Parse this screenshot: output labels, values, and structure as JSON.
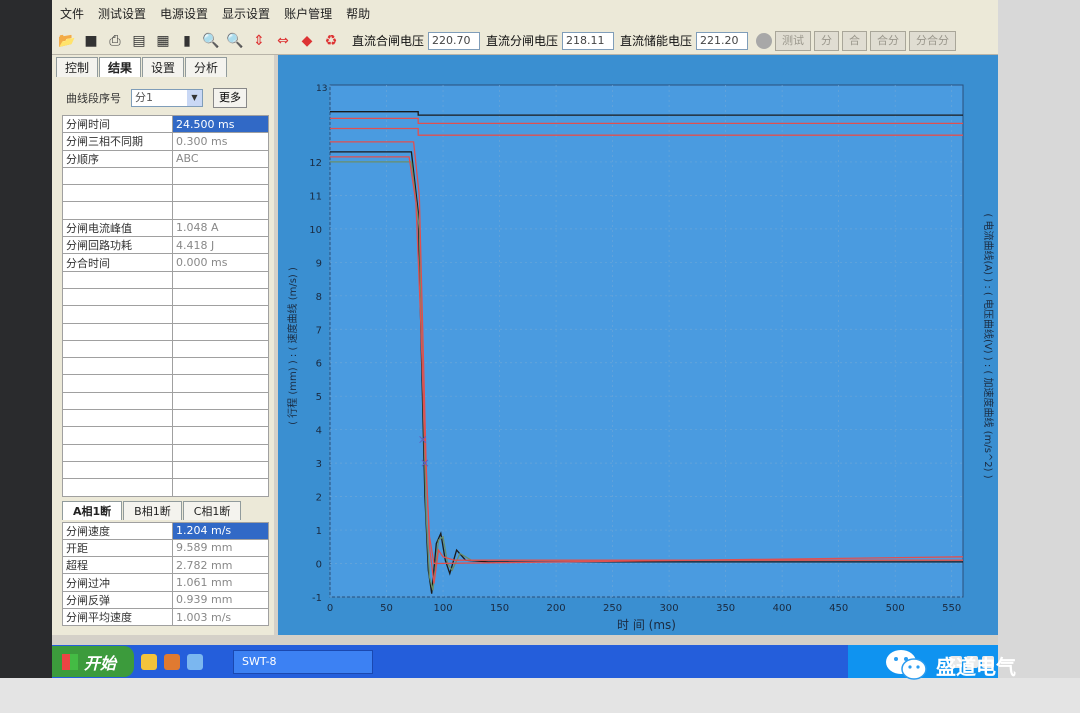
{
  "menu": [
    "文件",
    "测试设置",
    "电源设置",
    "显示设置",
    "账户管理",
    "帮助"
  ],
  "toolbar": {
    "icons": [
      "open-icon",
      "save-icon",
      "print-icon",
      "clipboard-icon",
      "export-icon",
      "book-icon",
      "zoom-out-icon",
      "zoom-in-icon",
      "vertical-scale-icon",
      "horizontal-scale-icon",
      "diamond-icon",
      "refresh-icon"
    ],
    "close_label": "直流合闸电压",
    "close_value": "220.70",
    "open_label": "直流分闸电压",
    "open_value": "218.11",
    "store_label": "直流储能电压",
    "store_value": "221.20",
    "btn_test": "测试",
    "btn_open": "分",
    "btn_close": "合",
    "btn_co": "合分",
    "btn_oc": "分合分"
  },
  "left": {
    "tabs": [
      "控制",
      "结果",
      "设置",
      "分析"
    ],
    "combo_label": "曲线段序号",
    "combo_value": "分1",
    "more_button": "更多",
    "rows": [
      {
        "label": "分闸时间",
        "value": "24.500  ms",
        "selected": true
      },
      {
        "label": "分闸三相不同期",
        "value": "0.300  ms"
      },
      {
        "label": "分顺序",
        "value": "ABC"
      },
      {
        "label": "",
        "value": ""
      },
      {
        "label": "",
        "value": ""
      },
      {
        "label": "",
        "value": ""
      },
      {
        "label": "分闸电流峰值",
        "value": "1.048  A"
      },
      {
        "label": "分闸回路功耗",
        "value": "4.418  J"
      },
      {
        "label": "分合时间",
        "value": "0.000  ms"
      },
      {
        "label": "",
        "value": ""
      },
      {
        "label": "",
        "value": ""
      },
      {
        "label": "",
        "value": ""
      },
      {
        "label": "",
        "value": ""
      },
      {
        "label": "",
        "value": ""
      },
      {
        "label": "",
        "value": ""
      },
      {
        "label": "",
        "value": ""
      },
      {
        "label": "",
        "value": ""
      },
      {
        "label": "",
        "value": ""
      },
      {
        "label": "",
        "value": ""
      },
      {
        "label": "",
        "value": ""
      },
      {
        "label": "",
        "value": ""
      },
      {
        "label": "",
        "value": ""
      }
    ],
    "phase_tabs": [
      "A相1断",
      "B相1断",
      "C相1断"
    ],
    "phase_rows": [
      {
        "label": "分闸速度",
        "value": "1.204  m/s",
        "selected": true
      },
      {
        "label": "开距",
        "value": "9.589  mm"
      },
      {
        "label": "超程",
        "value": "2.782  mm"
      },
      {
        "label": "分闸过冲",
        "value": "1.061  mm"
      },
      {
        "label": "分闸反弹",
        "value": "0.939  mm"
      },
      {
        "label": "分闸平均速度",
        "value": "1.003  m/s"
      }
    ]
  },
  "chart_data": {
    "type": "line",
    "xlabel": "时 间 (ms)",
    "ylabel_left": "( 行程 (mm) ) : ( 速度曲线 (m/s) )",
    "ylabel_right": "( 电流曲线(A) ) : ( 电压曲线(V) ) : ( 加速度曲线 (m/s^2) )",
    "xlim": [
      0,
      560
    ],
    "ylim": [
      -1,
      13
    ],
    "x_ticks": [
      0,
      50,
      100,
      150,
      200,
      250,
      300,
      350,
      400,
      450,
      500,
      550
    ],
    "y_ticks": [
      -1,
      0,
      1,
      2,
      3,
      4,
      5,
      6,
      7,
      8,
      9,
      10,
      11,
      12
    ],
    "top_tick_label": "13",
    "series": [
      {
        "color": "#1a1a1a",
        "points": [
          [
            0,
            12.3
          ],
          [
            72,
            12.3
          ],
          [
            78,
            10.5
          ],
          [
            81,
            6.0
          ],
          [
            84,
            2.0
          ],
          [
            87,
            -0.2
          ],
          [
            90,
            -0.9
          ],
          [
            94,
            0.6
          ],
          [
            98,
            0.9
          ],
          [
            102,
            0.1
          ],
          [
            106,
            -0.3
          ],
          [
            112,
            0.4
          ],
          [
            120,
            0.1
          ],
          [
            140,
            0.05
          ],
          [
            560,
            0.05
          ]
        ]
      },
      {
        "color": "#6a8f6a",
        "points": [
          [
            0,
            12.0
          ],
          [
            72,
            12.0
          ],
          [
            79,
            10.0
          ],
          [
            82,
            5.5
          ],
          [
            85,
            1.5
          ],
          [
            88,
            -0.4
          ],
          [
            91,
            -0.8
          ],
          [
            96,
            0.7
          ],
          [
            100,
            0.8
          ],
          [
            104,
            0.0
          ],
          [
            108,
            -0.2
          ],
          [
            115,
            0.3
          ],
          [
            125,
            0.1
          ],
          [
            560,
            0.1
          ]
        ]
      },
      {
        "color": "#e05050",
        "points": [
          [
            0,
            12.6
          ],
          [
            74,
            12.6
          ],
          [
            79,
            11.0
          ],
          [
            82,
            7.0
          ],
          [
            85,
            3.0
          ],
          [
            88,
            0.5
          ],
          [
            92,
            -0.6
          ],
          [
            96,
            0.4
          ],
          [
            100,
            0.2
          ],
          [
            110,
            0.1
          ],
          [
            560,
            0.1
          ]
        ]
      },
      {
        "color": "#e05050",
        "points": [
          [
            0,
            12.15
          ],
          [
            70,
            12.15
          ],
          [
            76,
            10.8
          ],
          [
            80,
            7.5
          ],
          [
            84,
            3.5
          ],
          [
            88,
            0.8
          ],
          [
            92,
            0.0
          ],
          [
            560,
            0.2
          ]
        ]
      }
    ],
    "top_lines": [
      {
        "color": "#1a1a1a",
        "points": [
          [
            0,
            13.5
          ],
          [
            78,
            13.5
          ],
          [
            78,
            13.4
          ],
          [
            560,
            13.4
          ]
        ]
      },
      {
        "color": "#e05050",
        "points": [
          [
            0,
            13.3
          ],
          [
            78,
            13.3
          ],
          [
            78,
            13.15
          ],
          [
            560,
            13.15
          ]
        ]
      },
      {
        "color": "#e05050",
        "points": [
          [
            0,
            13.0
          ],
          [
            78,
            13.0
          ],
          [
            78,
            12.8
          ],
          [
            560,
            12.8
          ]
        ]
      }
    ],
    "markers": [
      {
        "x": 82,
        "y": 3.7,
        "symbol": "x",
        "color": "#6060c0"
      },
      {
        "x": 84,
        "y": 3.0,
        "symbol": "x",
        "color": "#6060c0"
      }
    ]
  },
  "taskbar": {
    "start_label": "开始",
    "task_label": "SWT-8"
  },
  "watermark": "盛道电气"
}
